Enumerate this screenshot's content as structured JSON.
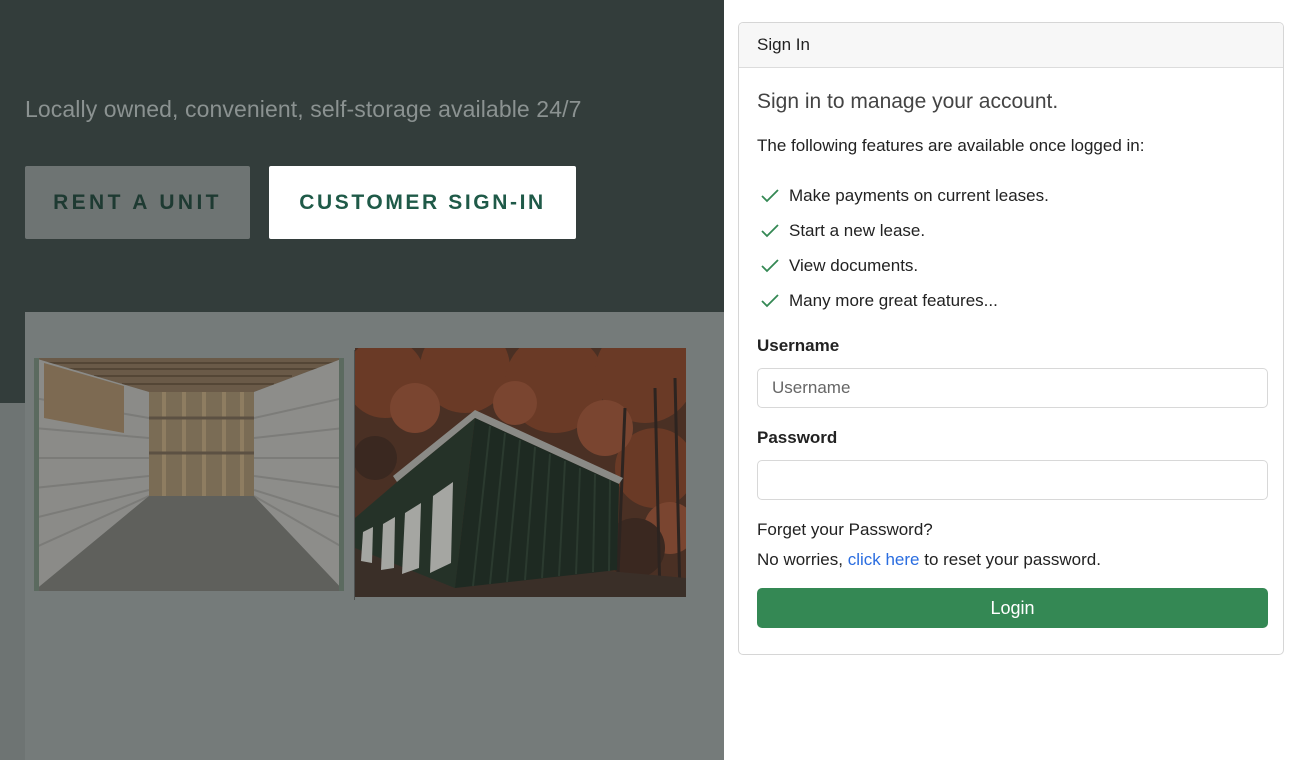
{
  "background": {
    "tagline": "Locally owned, convenient, self-storage available 24/7",
    "rent_button": "RENT A UNIT",
    "signin_button": "CUSTOMER SIGN-IN",
    "images": {
      "unit_interior": "storage unit interior photo",
      "building_exterior": "storage building exterior photo"
    }
  },
  "signin_card": {
    "header": "Sign In",
    "lead": "Sign in to manage your account.",
    "intro": "The following features are available once logged in:",
    "features": [
      "Make payments on current leases.",
      "Start a new lease.",
      "View documents.",
      "Many more great features..."
    ],
    "username_label": "Username",
    "username_placeholder": "Username",
    "username_value": "",
    "password_label": "Password",
    "password_value": "",
    "forgot_title": "Forget your Password?",
    "forgot_prefix": "No worries, ",
    "forgot_link": "click here",
    "forgot_suffix": " to reset your password.",
    "login_button": "Login"
  },
  "colors": {
    "hero_bg": "#333d3b",
    "overlay_bg": "#6e7473",
    "login_green": "#348854",
    "link_blue": "#2a6de0",
    "check_green": "#348854"
  },
  "icons": {
    "feature_check": "check-icon"
  }
}
